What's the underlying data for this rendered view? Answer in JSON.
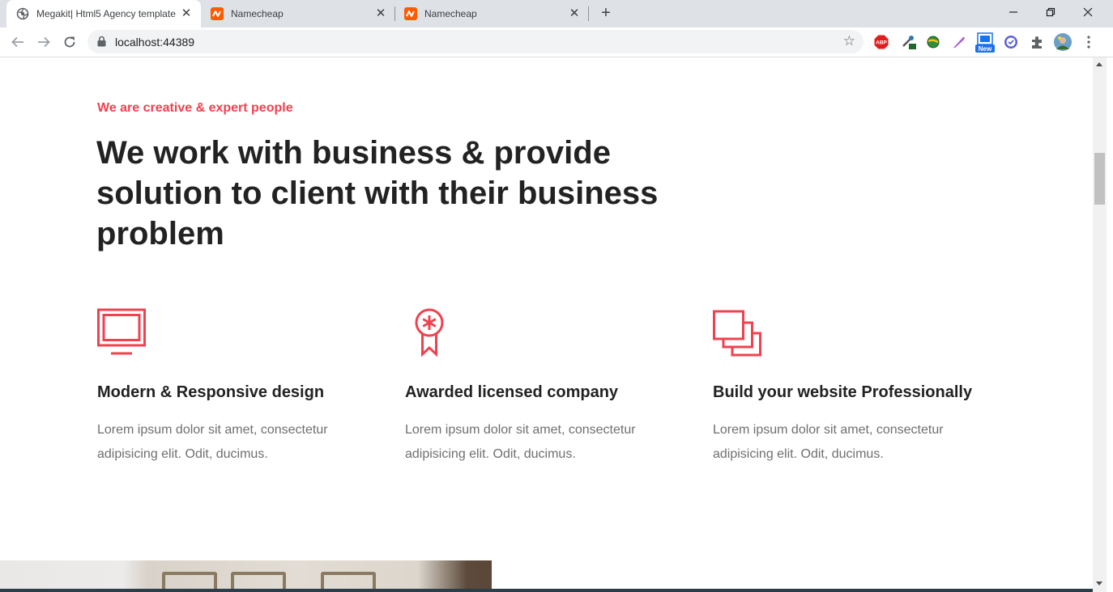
{
  "browser": {
    "tabs": [
      {
        "title": "Megakit| Html5 Agency template",
        "favicon": "globe-icon",
        "active": true
      },
      {
        "title": "Namecheap",
        "favicon": "namecheap-icon",
        "active": false
      },
      {
        "title": "Namecheap",
        "favicon": "namecheap-icon",
        "active": false
      }
    ],
    "close_glyph": "✕",
    "new_tab_glyph": "+",
    "url": "localhost:44389",
    "extensions": [
      "adblock-plus-icon",
      "dropper-icon",
      "globe-extension-icon",
      "feather-icon",
      "new-badge-icon",
      "check-circle-icon",
      "puzzle-icon",
      "avatar",
      "menu-icon"
    ],
    "extension_texts": {
      "adblock": "ABP",
      "new_badge": "New"
    },
    "accent_colors": {
      "brand_red": "#f0414f",
      "namecheap_orange": "#ff5a00"
    }
  },
  "page": {
    "subheading": "We are creative & expert people",
    "heading": "We work with business & provide solution to client with their business problem",
    "features": [
      {
        "icon": "monitor-icon",
        "title": "Modern & Responsive design",
        "description": "Lorem ipsum dolor sit amet, consectetur adipisicing elit. Odit, ducimus."
      },
      {
        "icon": "award-icon",
        "title": "Awarded licensed company",
        "description": "Lorem ipsum dolor sit amet, consectetur adipisicing elit. Odit, ducimus."
      },
      {
        "icon": "layers-icon",
        "title": "Build your website Professionally",
        "description": "Lorem ipsum dolor sit amet, consectetur adipisicing elit. Odit, ducimus."
      }
    ]
  }
}
